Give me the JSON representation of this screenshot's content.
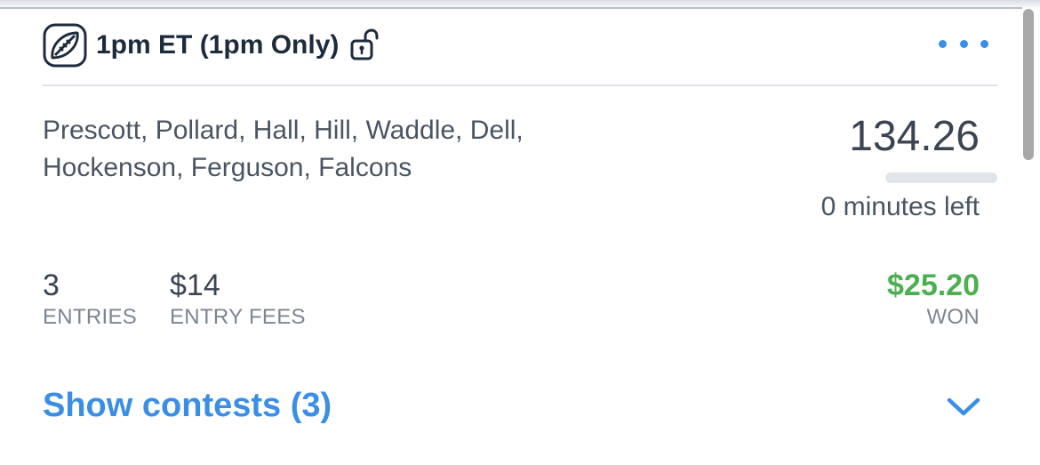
{
  "contest": {
    "title": "1pm ET (1pm Only)",
    "lineup": "Prescott, Pollard, Hall, Hill, Waddle, Dell, Hockenson, Ferguson, Falcons",
    "score": "134.26",
    "progress_remaining_fraction": 0,
    "time_left": "0 minutes left"
  },
  "stats": {
    "entries": {
      "value": "3",
      "label": "ENTRIES"
    },
    "entry_fees": {
      "value": "$14",
      "label": "ENTRY FEES"
    },
    "won": {
      "value": "$25.20",
      "label": "WON"
    }
  },
  "footer": {
    "show_contests_label": "Show contests (3)"
  },
  "icons": {
    "sport": "football-icon",
    "lock": "unlocked-lock-icon",
    "menu": "more-options-icon",
    "expand": "chevron-down-icon"
  },
  "colors": {
    "accent": "#3a8ee6",
    "won": "#4caf50",
    "title": "#1e2b3c",
    "body_text": "#4a5563",
    "label_text": "#7c8591"
  }
}
